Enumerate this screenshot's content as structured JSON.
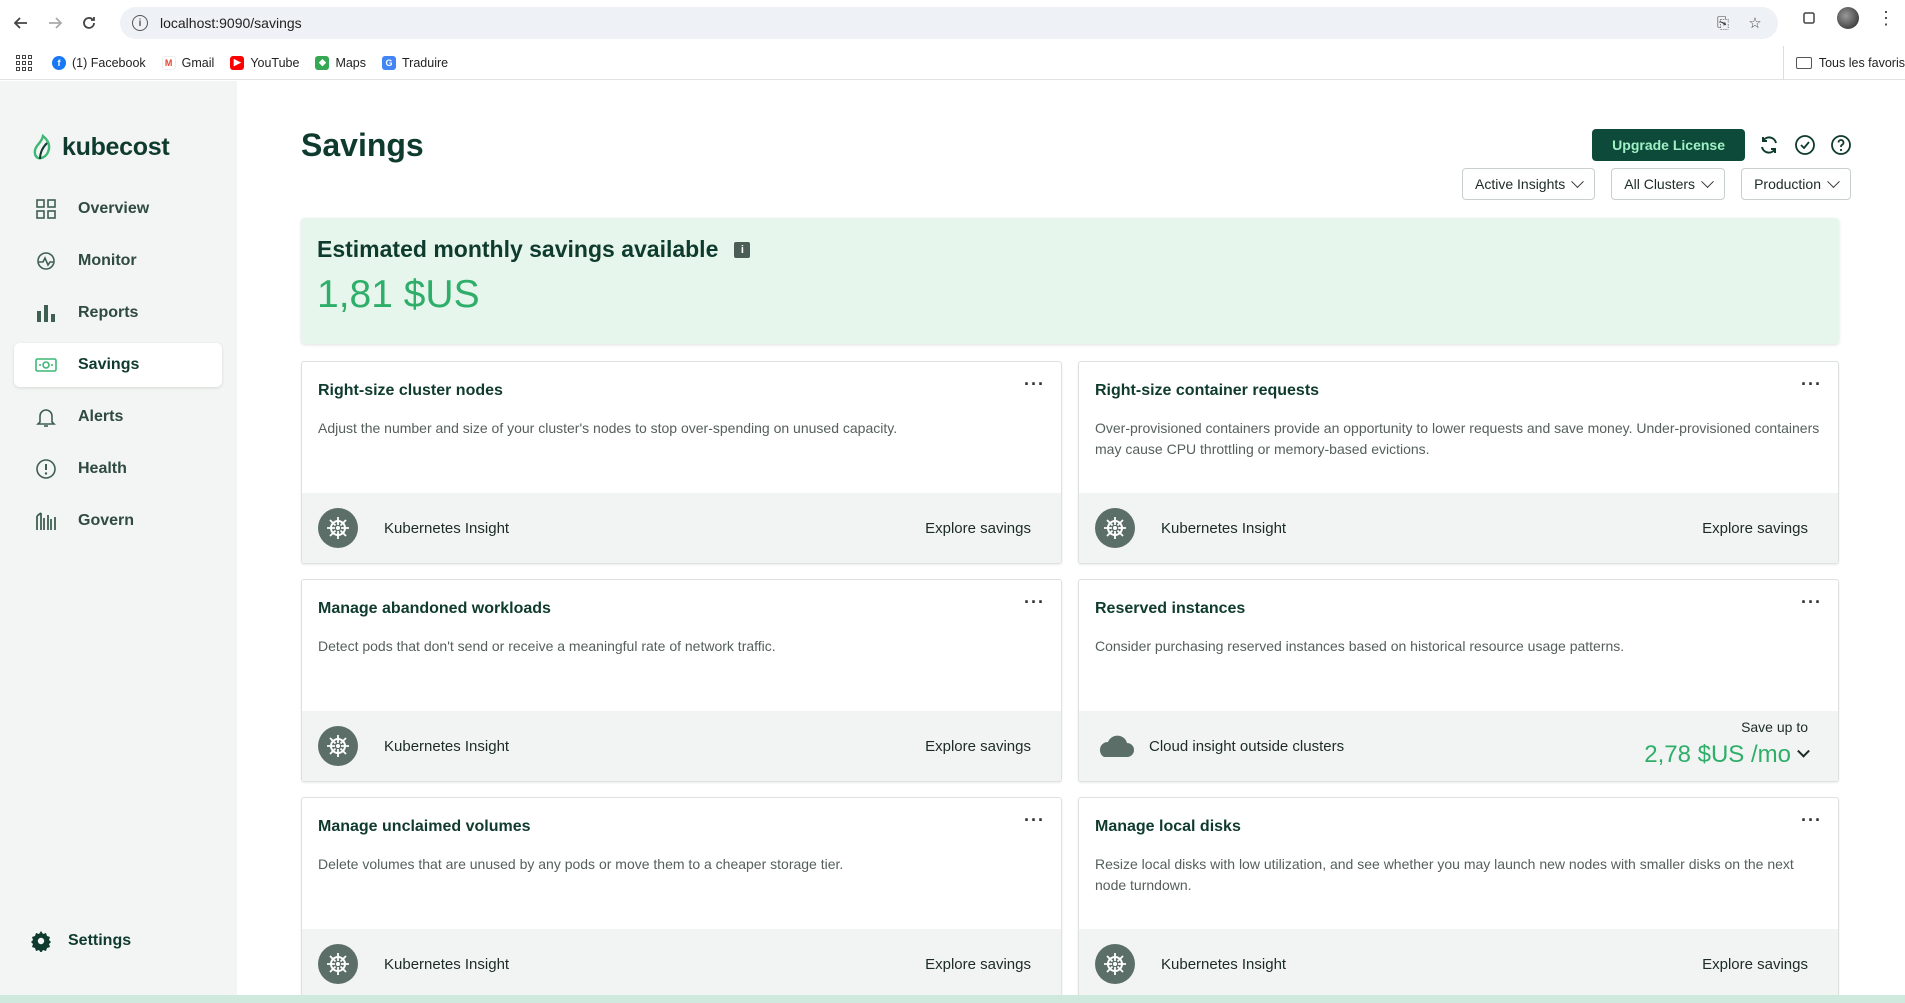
{
  "browser": {
    "url": "localhost:9090/savings",
    "bookmarks": [
      {
        "label": "(1) Facebook",
        "icon": "facebook-icon",
        "color": "#1877f2"
      },
      {
        "label": "Gmail",
        "icon": "gmail-icon",
        "color": "#ea4335"
      },
      {
        "label": "YouTube",
        "icon": "youtube-icon",
        "color": "#ff0000"
      },
      {
        "label": "Maps",
        "icon": "maps-icon",
        "color": "#34a853"
      },
      {
        "label": "Traduire",
        "icon": "translate-icon",
        "color": "#4285f4"
      }
    ],
    "all_bookmarks": "Tous les favoris"
  },
  "sidebar": {
    "brand": "kubecost",
    "items": [
      {
        "label": "Overview",
        "icon": "grid-icon"
      },
      {
        "label": "Monitor",
        "icon": "monitor-icon"
      },
      {
        "label": "Reports",
        "icon": "bar-chart-icon"
      },
      {
        "label": "Savings",
        "icon": "money-icon",
        "active": true
      },
      {
        "label": "Alerts",
        "icon": "bell-icon"
      },
      {
        "label": "Health",
        "icon": "alert-circle-icon"
      },
      {
        "label": "Govern",
        "icon": "govern-icon"
      }
    ],
    "settings": "Settings"
  },
  "header": {
    "title": "Savings",
    "upgrade": "Upgrade License",
    "filters": [
      "Active Insights",
      "All Clusters",
      "Production"
    ]
  },
  "hero": {
    "title": "Estimated monthly savings available",
    "info": "i",
    "amount": "1,81 $US"
  },
  "cards": [
    {
      "title": "Right-size cluster nodes",
      "desc": "Adjust the number and size of your cluster's nodes to stop over-spending on unused capacity.",
      "footer": "Kubernetes Insight",
      "action": "Explore savings"
    },
    {
      "title": "Right-size container requests",
      "desc": "Over-provisioned containers provide an opportunity to lower requests and save money. Under-provisioned containers may cause CPU throttling or memory-based evictions.",
      "footer": "Kubernetes Insight",
      "action": "Explore savings"
    },
    {
      "title": "Manage abandoned workloads",
      "desc": "Detect pods that don't send or receive a meaningful rate of network traffic.",
      "footer": "Kubernetes Insight",
      "action": "Explore savings"
    },
    {
      "title": "Reserved instances",
      "desc": "Consider purchasing reserved instances based on historical resource usage patterns.",
      "footer": "Cloud insight outside clusters",
      "save_label": "Save up to",
      "save_amount": "2,78 $US /mo"
    },
    {
      "title": "Manage unclaimed volumes",
      "desc": "Delete volumes that are unused by any pods or move them to a cheaper storage tier.",
      "footer": "Kubernetes Insight",
      "action": "Explore savings"
    },
    {
      "title": "Manage local disks",
      "desc": "Resize local disks with low utilization, and see whether you may launch new nodes with smaller disks on the next node turndown.",
      "footer": "Kubernetes Insight",
      "action": "Explore savings"
    }
  ],
  "colors": {
    "brand_dark": "#0f3b2e",
    "accent_green": "#2fae6a",
    "hero_bg": "#e6f6ec"
  }
}
